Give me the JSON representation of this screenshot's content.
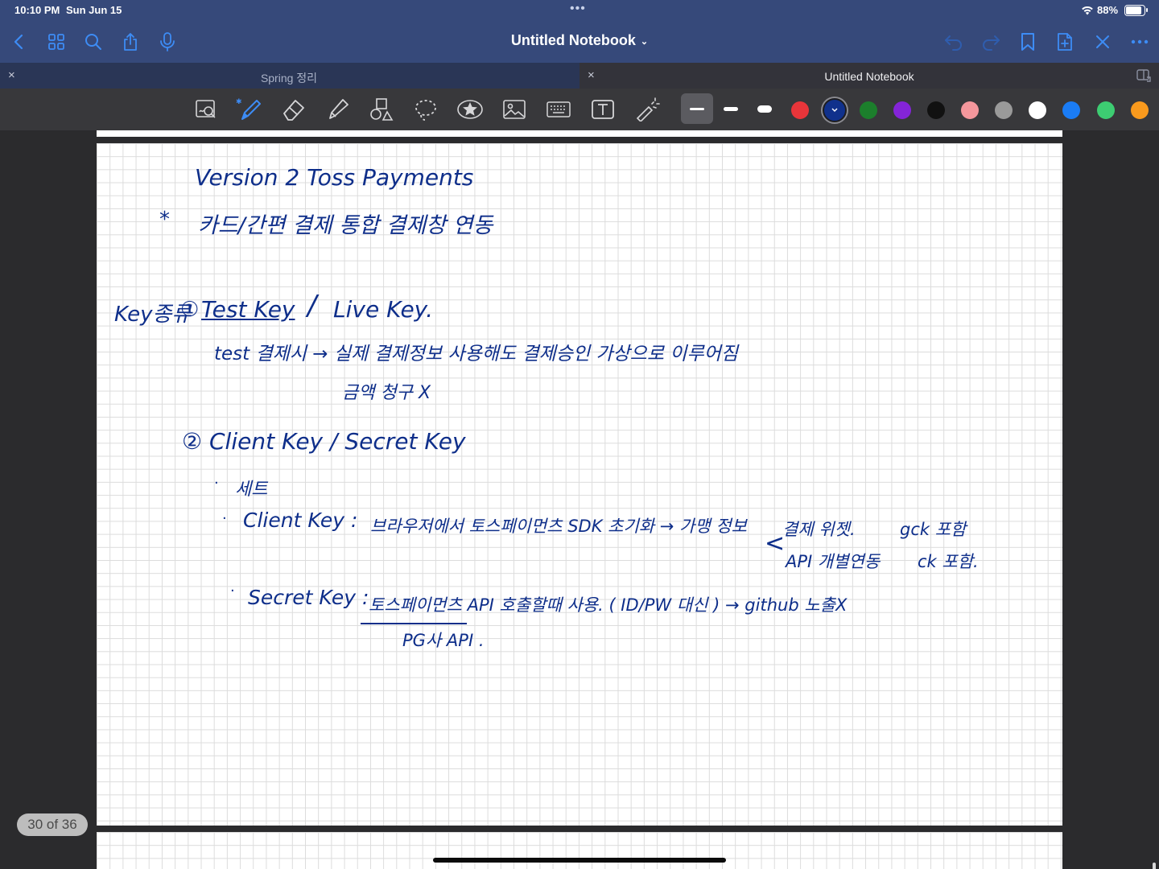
{
  "status_bar": {
    "time": "10:10 PM",
    "date": "Sun Jun 15",
    "dots": "•••",
    "battery": "88%"
  },
  "nav": {
    "title": "Untitled Notebook",
    "icons": [
      "back-icon",
      "grid-icon",
      "search-icon",
      "share-icon",
      "microphone-icon",
      "undo-icon",
      "redo-icon",
      "bookmark-icon",
      "add-page-icon",
      "close-icon",
      "more-icon"
    ]
  },
  "tabs": [
    {
      "label": "Spring 정리",
      "close": "×",
      "active": false
    },
    {
      "label": "Untitled Notebook",
      "close": "×",
      "active": true
    }
  ],
  "toolbar": {
    "tools": [
      "zoom-window",
      "pen",
      "eraser",
      "highlighter",
      "shapes",
      "lasso",
      "elements",
      "image",
      "keyboard",
      "text",
      "laser-pointer"
    ],
    "colors": [
      "#e8353a",
      "#10318c",
      "#1c7f2c",
      "#8424d8",
      "#111111",
      "#f4979c",
      "#9a9a9a",
      "#ffffff",
      "#1a7cf5",
      "#3dcd72",
      "#f99a1d"
    ],
    "selected_color": "#10318c"
  },
  "note": {
    "line1": "Version 2 Toss Payments",
    "line2_star": "*",
    "line2": "카드/간편 결제 통합 결제창 연동",
    "key_label": "Key종류",
    "key_1_num": "①",
    "key_1_test": "Test Key",
    "key_1_sep": "/",
    "key_1_live": "Live Key.",
    "test_line": "test 결제시 → 실제 결제정보 사용해도 결제승인 가상으로 이루어짐",
    "test_line_2": "금액 청구 X",
    "key_2": "② Client Key / Secret Key",
    "bullet_1": "세트",
    "bullet_2_label": "Client Key :",
    "bullet_2_text": "브라우저에서 토스페이먼츠 SDK 초기화 → 가맹 정보",
    "bullet_2_branch_1": "결제 위젯.",
    "bullet_2_branch_1_tag": "gck 포함",
    "bullet_2_branch_2": "API 개별연동",
    "bullet_2_branch_2_tag": "ck 포함.",
    "bullet_3_label": "Secret Key :",
    "bullet_3_text": "토스페이먼츠 API 호출할때 사용. ( ID/PW 대신 ) → github 노출X",
    "bullet_3_sub": "PG사 API ."
  },
  "page_indicator": "30 of 36"
}
